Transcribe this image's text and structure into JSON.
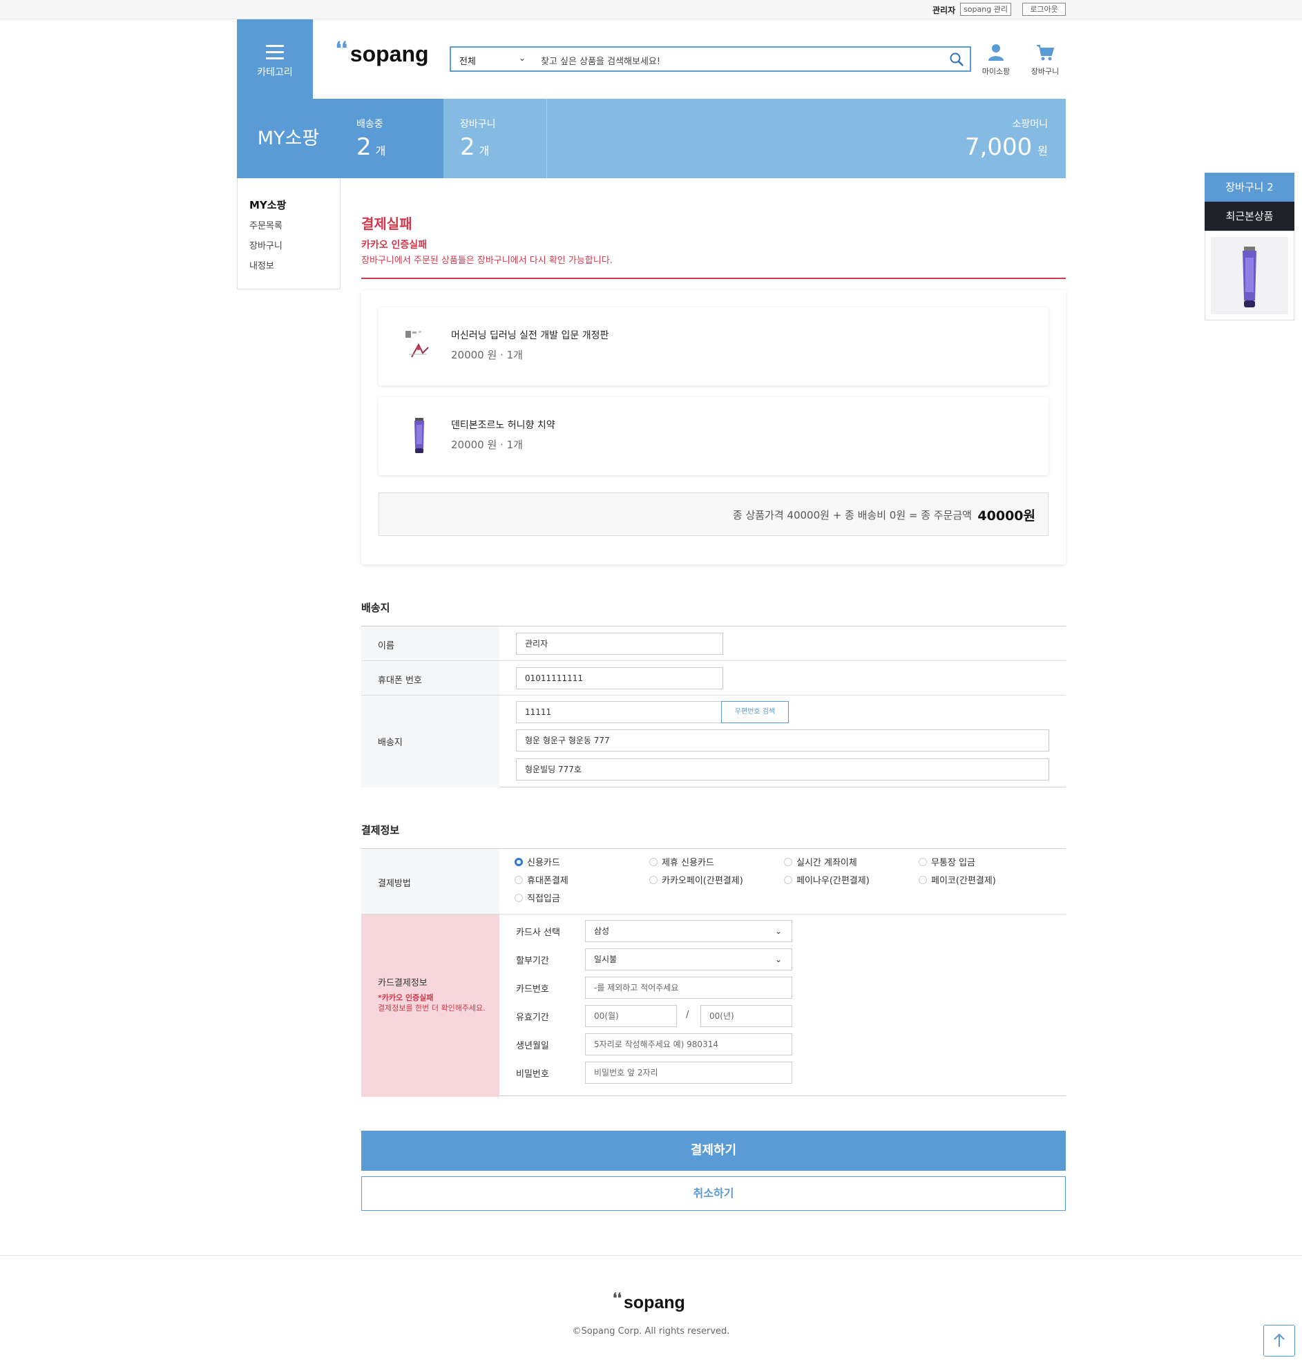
{
  "topbar": {
    "user": "관리자",
    "admin_link": "sopang 관리",
    "logout": "로그아웃"
  },
  "header": {
    "category_label": "카테고리",
    "logo": "sopang",
    "search": {
      "category": "전체",
      "placeholder": "찾고 싶은 상품을 검색해보세요!"
    },
    "mypage_label": "마이소팡",
    "cart_label": "장바구니"
  },
  "banner": {
    "title": "MY소팡",
    "shipping": {
      "label": "배송중",
      "value": "2",
      "unit": "개"
    },
    "cart": {
      "label": "장바구니",
      "value": "2",
      "unit": "개"
    },
    "money": {
      "label": "소팡머니",
      "value": "7,000",
      "unit": "원"
    }
  },
  "sidenav": {
    "title": "MY소팡",
    "items": [
      "주문목록",
      "장바구니",
      "내정보"
    ]
  },
  "result": {
    "title": "결제실패",
    "reason": "카카오 인증실패",
    "desc": "장바구니에서 주문된 상품들은 장바구니에서 다시 확인 가능합니다."
  },
  "order": {
    "items": [
      {
        "name": "머신러닝 딥러닝 실전 개발 입문 개정판",
        "price": "20000 원 · 1개"
      },
      {
        "name": "덴티본조르노 허니향 치약",
        "price": "20000 원 · 1개"
      }
    ],
    "summary": "종 상품가격 40000원 + 종 배송비 0원 = 종 주문금액",
    "total": "40000원"
  },
  "shipping": {
    "title": "배송지",
    "name_label": "이름",
    "name": "관리자",
    "phone_label": "휴대폰 번호",
    "phone": "01011111111",
    "address_label": "배송지",
    "zip": "11111",
    "zip_button": "우편번호 검색",
    "address1": "형운 형운구 형운동 777",
    "address2": "형운빌딩 777호"
  },
  "payment": {
    "title": "결제정보",
    "method_label": "결제방법",
    "methods": [
      "신용카드",
      "제휴 신용카드",
      "실시간 계좌이체",
      "무통장 입금",
      "휴대폰결제",
      "카카오페이(간편결제)",
      "페이나우(간편결제)",
      "페이코(간편결제)",
      "직접입금"
    ],
    "selected_method": "신용카드",
    "card_info_label": "카드결제정보",
    "card_error": "*카카오 인증실패",
    "card_error_desc": "결제정보를 한번 더 확인해주세요.",
    "fields": {
      "company_label": "카드사 선택",
      "company": "삼성",
      "installment_label": "할부기간",
      "installment": "일시불",
      "number_label": "카드번호",
      "number_ph": "-를 제외하고 적어주세요",
      "expiry_label": "유효기간",
      "month_ph": "00(월)",
      "year_ph": "00(년)",
      "separator": "/",
      "birth_label": "생년월일",
      "birth_ph": "5자리로 작성해주세요 예) 980314",
      "pw_label": "비밀번호",
      "pw_ph": "비밀번호 앞 2자리"
    }
  },
  "buttons": {
    "pay": "결제하기",
    "cancel": "취소하기"
  },
  "floating": {
    "cart": "장바구니 2",
    "recent": "최근본상품"
  },
  "footer": {
    "logo": "sopang",
    "copyright": "©Sopang Corp. All rights reserved."
  },
  "colors": {
    "primary": "#5a9bd5",
    "banner": "#85bbe3",
    "error": "#d0394b",
    "card_bg": "#f8d7dc"
  }
}
